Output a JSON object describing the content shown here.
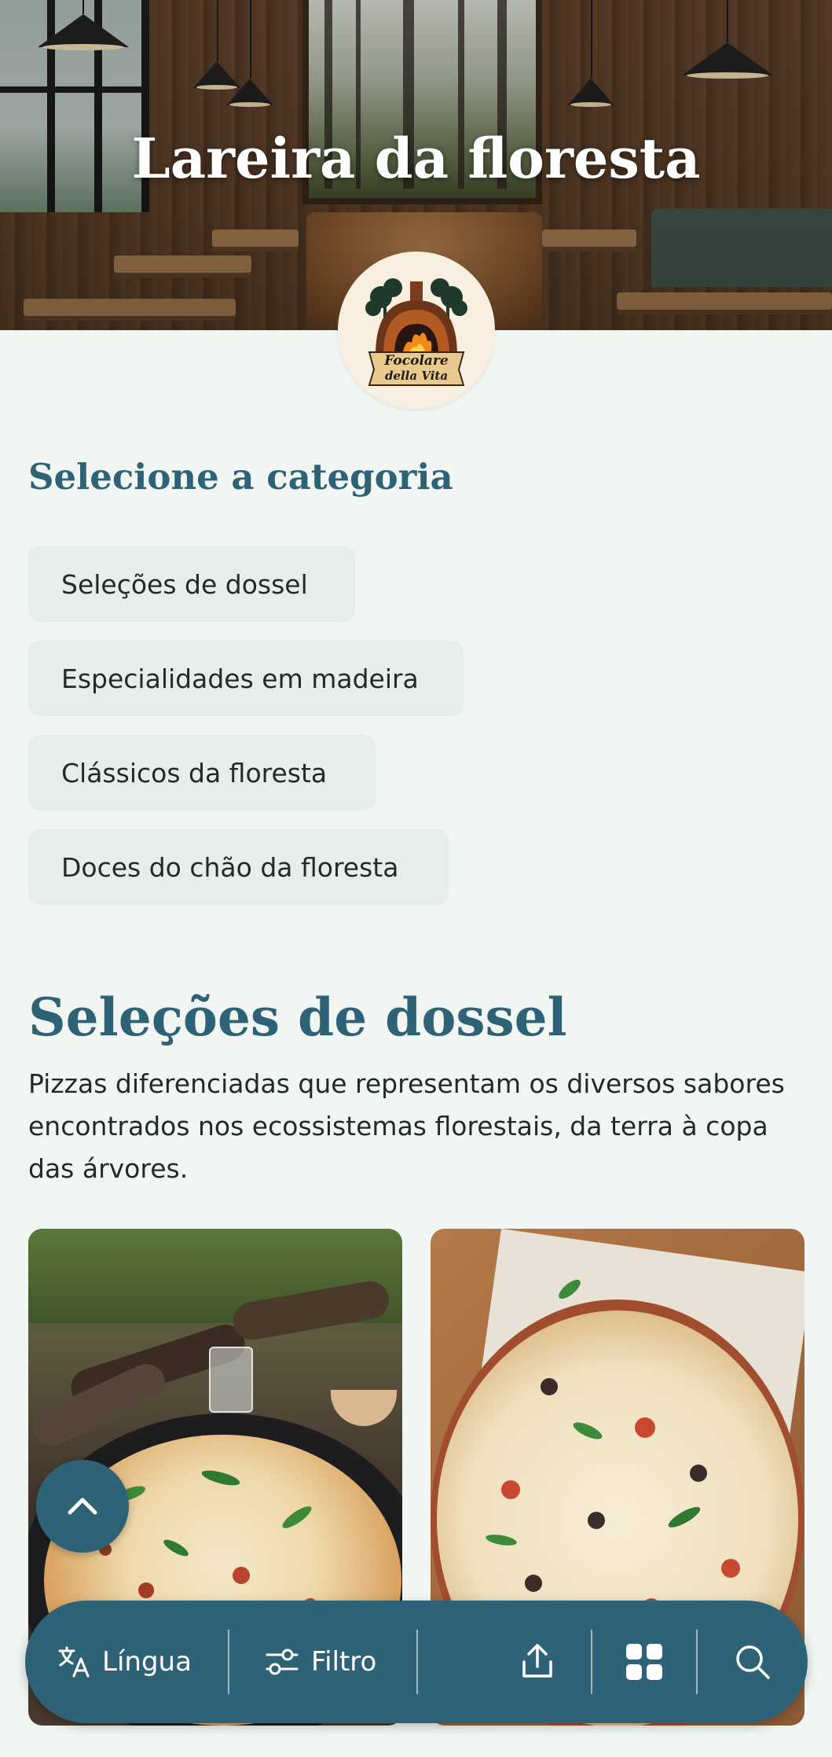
{
  "hero": {
    "title": "Lareira da floresta"
  },
  "logo": {
    "name": "Focolare della Vita",
    "line1": "Focolare",
    "line2": "della Vita"
  },
  "categories": {
    "heading": "Selecione a categoria",
    "items": [
      {
        "label": "Seleções de dossel"
      },
      {
        "label": "Especialidades em madeira"
      },
      {
        "label": "Clássicos da floresta"
      },
      {
        "label": "Doces do chão da floresta"
      }
    ]
  },
  "section": {
    "title": "Seleções de dossel",
    "description": "Pizzas diferenciadas que representam os diversos sabores encontrados nos ecossistemas florestais, da terra à copa das árvores."
  },
  "toolbar": {
    "language_label": "Língua",
    "filter_label": "Filtro",
    "icons": [
      "translate-icon",
      "filter-sliders-icon",
      "share-icon",
      "grid-icon",
      "search-icon"
    ]
  },
  "colors": {
    "accent": "#2e6277",
    "background": "#f2f6f3",
    "chip": "#e6eeea"
  }
}
